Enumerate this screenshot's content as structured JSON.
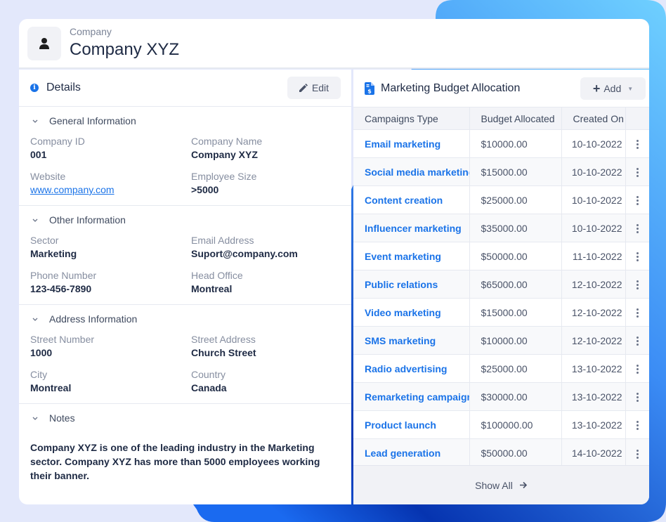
{
  "colors": {
    "accent": "#1a73e8",
    "background": "#e3e8fb",
    "gradient_start": "#4f8ef7",
    "gradient_end": "#0a3fbf"
  },
  "header": {
    "subtitle": "Company",
    "title": "Company XYZ",
    "avatar_icon": "user-icon"
  },
  "details": {
    "title": "Details",
    "icon": "info-icon",
    "edit_label": "Edit",
    "sections": [
      {
        "title": "General Information",
        "fields": [
          {
            "label": "Company ID",
            "value": "001"
          },
          {
            "label": "Company Name",
            "value": "Company XYZ"
          },
          {
            "label": "Website",
            "value": "www.company.com"
          },
          {
            "label": "Employee Size",
            "value": ">5000"
          }
        ]
      },
      {
        "title": "Other Information",
        "fields": [
          {
            "label": "Sector",
            "value": "Marketing"
          },
          {
            "label": "Email Address",
            "value": "Suport@company.com"
          },
          {
            "label": "Phone Number",
            "value": "123-456-7890"
          },
          {
            "label": "Head Office",
            "value": "Montreal"
          }
        ]
      },
      {
        "title": "Address Information",
        "fields": [
          {
            "label": "Street Number",
            "value": "1000"
          },
          {
            "label": "Street Address",
            "value": "Church Street"
          },
          {
            "label": "City",
            "value": "Montreal"
          },
          {
            "label": "Country",
            "value": "Canada"
          }
        ]
      }
    ],
    "notes": {
      "title": "Notes",
      "text": "Company XYZ is one of the leading industry in the Marketing sector. Company XYZ has more than 5000 employees working their banner."
    }
  },
  "budget": {
    "title": "Marketing Budget Allocation",
    "icon": "invoice-dollar-icon",
    "add_label": "Add",
    "columns": [
      "Campaigns Type",
      "Budget Allocated",
      "Created On"
    ],
    "rows": [
      {
        "campaign": "Email marketing",
        "budget": "$10000.00",
        "created": "10-10-2022"
      },
      {
        "campaign": "Social media marketing",
        "budget": "$15000.00",
        "created": "10-10-2022"
      },
      {
        "campaign": "Content creation",
        "budget": "$25000.00",
        "created": "10-10-2022"
      },
      {
        "campaign": "Influencer marketing",
        "budget": "$35000.00",
        "created": "10-10-2022"
      },
      {
        "campaign": "Event marketing",
        "budget": "$50000.00",
        "created": "11-10-2022"
      },
      {
        "campaign": "Public relations",
        "budget": "$65000.00",
        "created": "12-10-2022"
      },
      {
        "campaign": "Video marketing",
        "budget": "$15000.00",
        "created": "12-10-2022"
      },
      {
        "campaign": "SMS marketing",
        "budget": "$10000.00",
        "created": "12-10-2022"
      },
      {
        "campaign": "Radio advertising",
        "budget": "$25000.00",
        "created": "13-10-2022"
      },
      {
        "campaign": "Remarketing campaign",
        "budget": "$30000.00",
        "created": "13-10-2022"
      },
      {
        "campaign": "Product launch",
        "budget": "$100000.00",
        "created": "13-10-2022"
      },
      {
        "campaign": "Lead generation",
        "budget": "$50000.00",
        "created": "14-10-2022"
      }
    ],
    "show_all_label": "Show All"
  }
}
